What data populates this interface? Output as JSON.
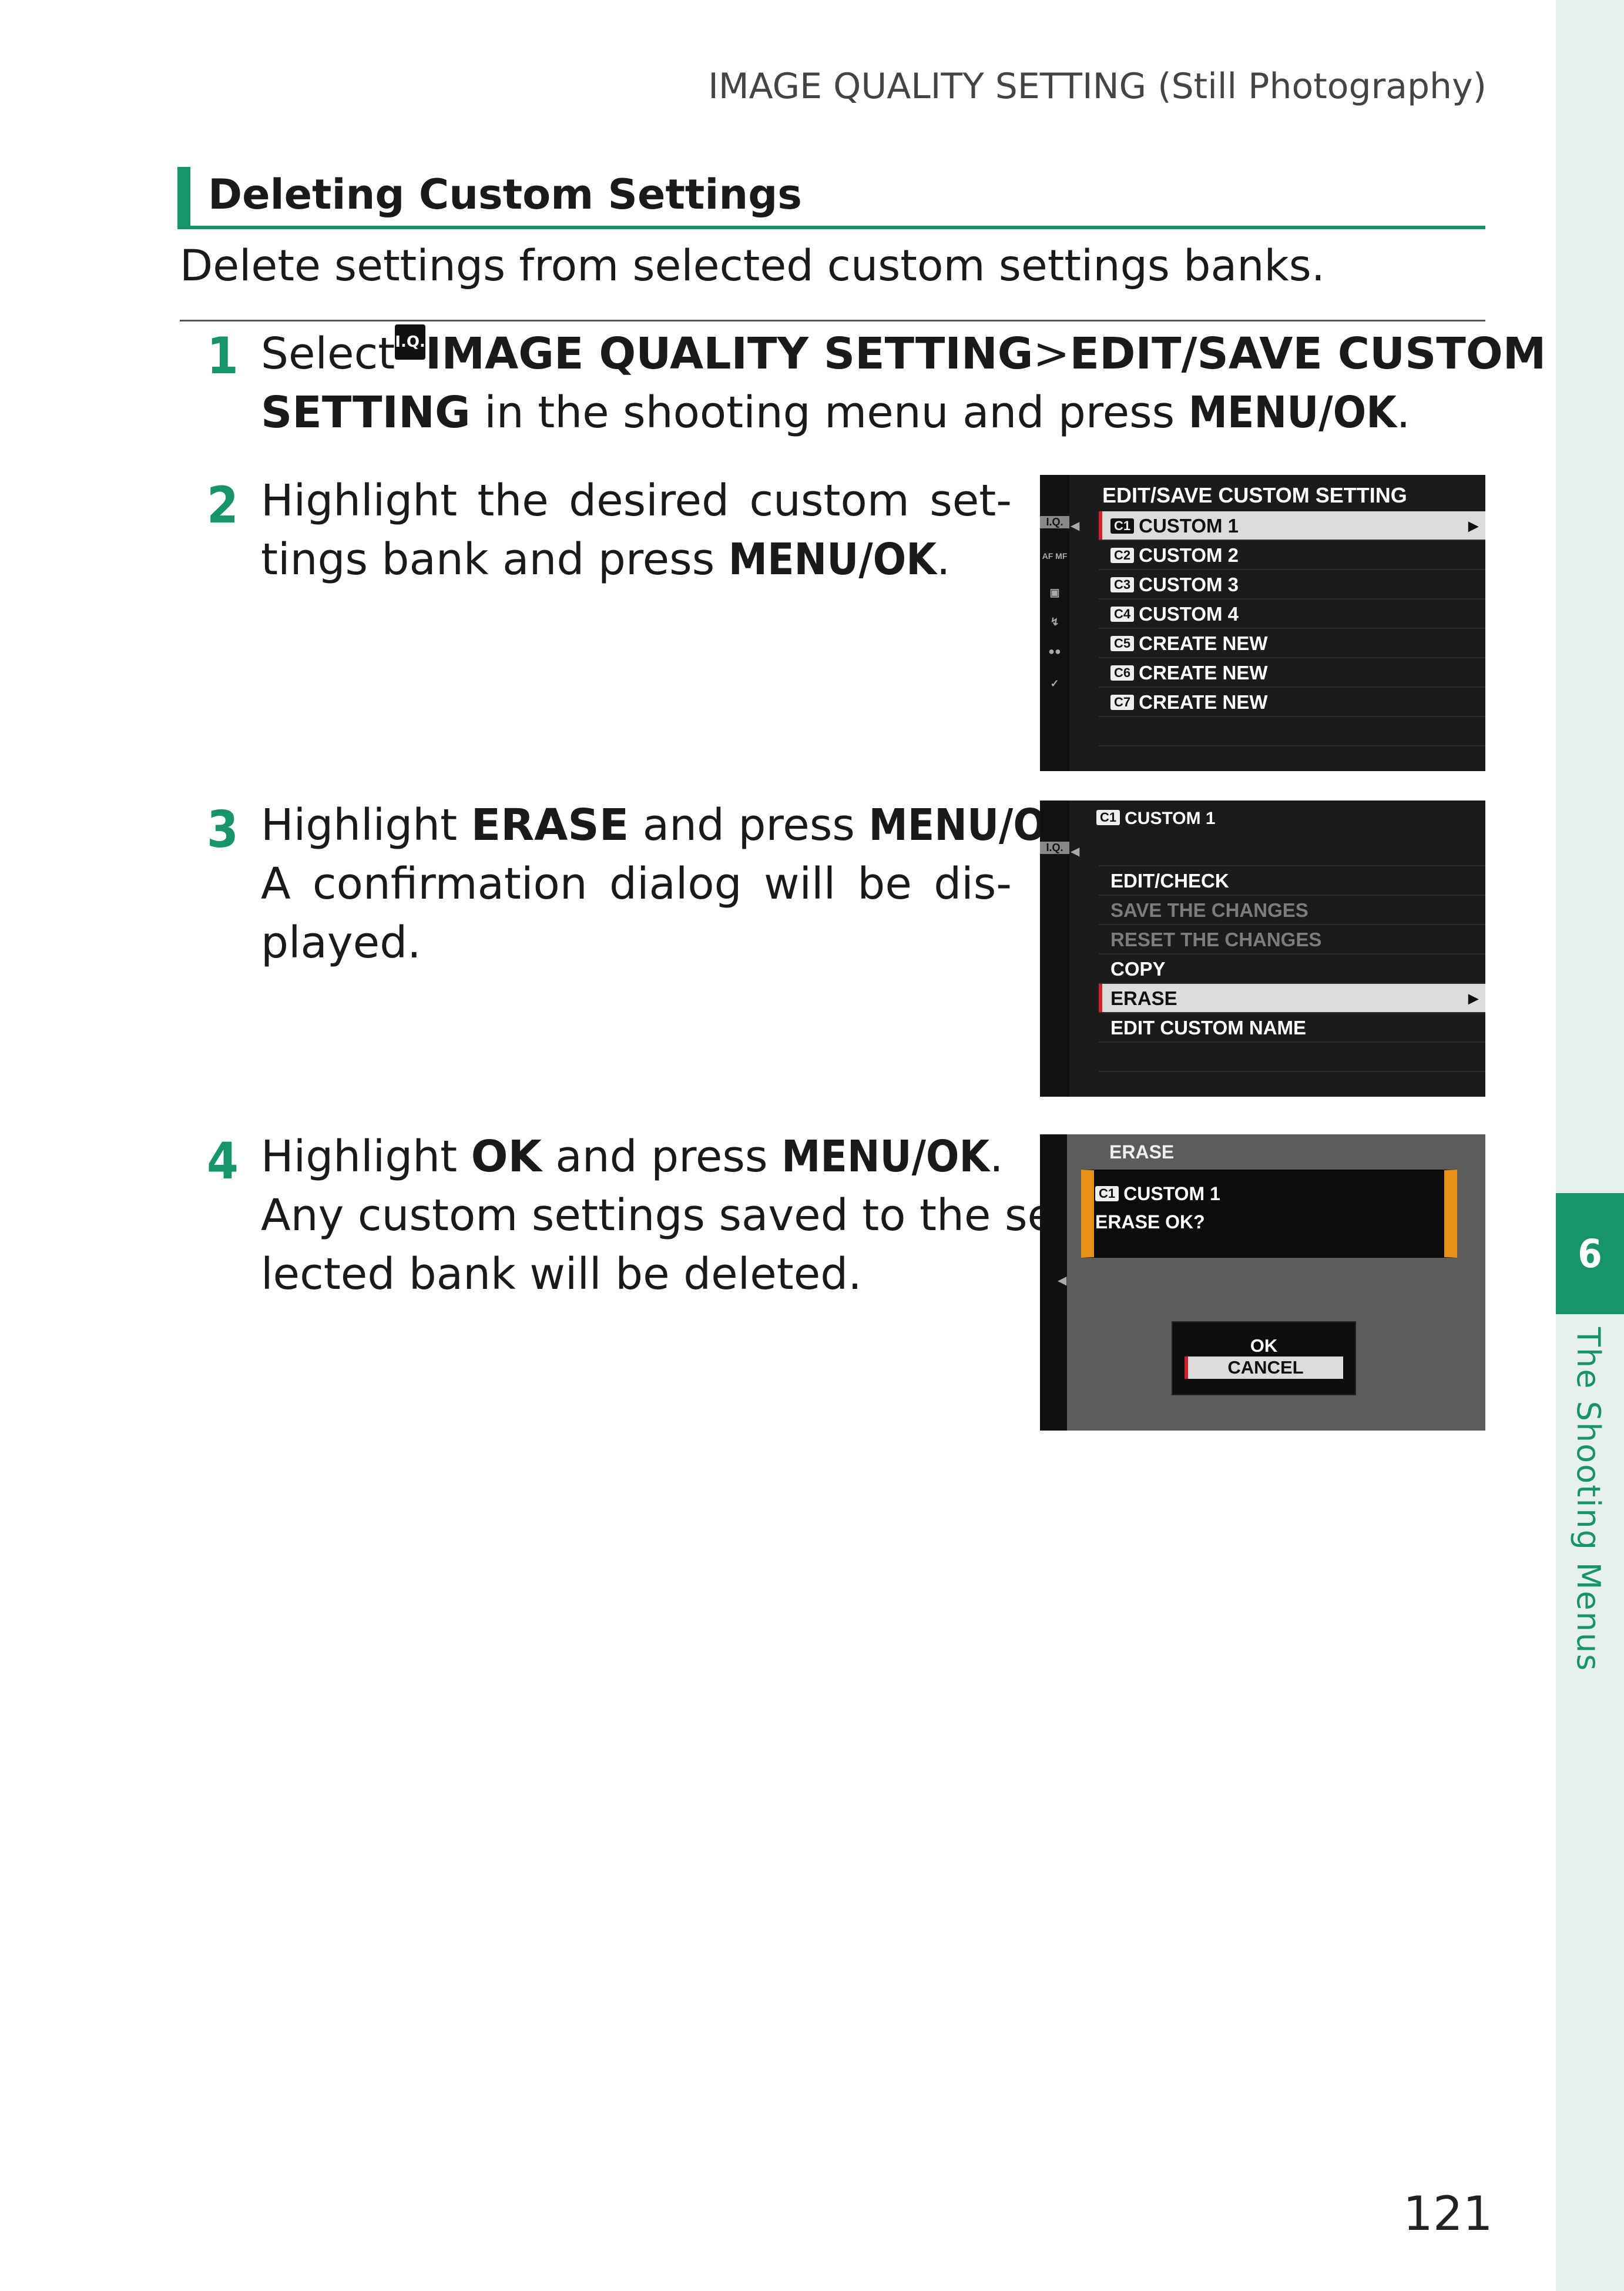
{
  "running_head": "IMAGE QUALITY SETTING (Still Photography)",
  "section": {
    "title": "Deleting Custom Settings",
    "intro": "Delete settings from selected custom settings banks."
  },
  "steps": [
    {
      "number": "1",
      "p1": "Select ",
      "icon_label": "I.Q.",
      "b1": "IMAGE QUALITY SETTING",
      "p2": " > ",
      "b2": "EDIT/SAVE CUSTOM",
      "b3": "SETTING",
      "p3": " in the shooting menu and press ",
      "key": "MENU/OK",
      "p4": "."
    },
    {
      "number": "2",
      "line1": "Highlight the desired custom set-",
      "line2_pre": "tings bank and press ",
      "key": "MENU/OK",
      "line2_post": "."
    },
    {
      "number": "3",
      "p1": "Highlight ",
      "b1": "ERASE",
      "p2": " and press ",
      "key": "MENU/OK",
      "p3": ".",
      "line2": "A confirmation dialog will be dis-",
      "line3": "played."
    },
    {
      "number": "4",
      "p1": "Highlight ",
      "b1": "OK",
      "p2": " and press ",
      "key": "MENU/OK",
      "p3": ".",
      "line2": "Any custom settings saved to the se-",
      "line3": "lected bank will be deleted."
    }
  ],
  "screen1": {
    "title": "EDIT/SAVE CUSTOM SETTING",
    "side_icons": [
      "I.Q.",
      "AF MF",
      "camera-icon",
      "flash-icon",
      "movie-icon",
      "wrench-icon"
    ],
    "rows": [
      {
        "badge": "C1",
        "label": "CUSTOM 1",
        "selected": true
      },
      {
        "badge": "C2",
        "label": "CUSTOM 2"
      },
      {
        "badge": "C3",
        "label": "CUSTOM 3"
      },
      {
        "badge": "C4",
        "label": "CUSTOM 4"
      },
      {
        "badge": "C5",
        "label": "CREATE NEW"
      },
      {
        "badge": "C6",
        "label": "CREATE NEW"
      },
      {
        "badge": "C7",
        "label": "CREATE NEW"
      }
    ]
  },
  "screen2": {
    "badge": "C1",
    "title": "CUSTOM 1",
    "side_icon": "I.Q.",
    "rows": [
      {
        "label": "EDIT/CHECK"
      },
      {
        "label": "SAVE THE CHANGES",
        "dim": true
      },
      {
        "label": "RESET THE CHANGES",
        "dim": true
      },
      {
        "label": "COPY"
      },
      {
        "label": "ERASE",
        "selected": true
      },
      {
        "label": "EDIT CUSTOM NAME"
      }
    ]
  },
  "screen3": {
    "title": "ERASE",
    "badge": "C1",
    "line1": "CUSTOM 1",
    "line2": "ERASE OK?",
    "ok": "OK",
    "cancel": "CANCEL"
  },
  "side_tab": {
    "chapter_number": "6",
    "chapter_title": "The Shooting Menus"
  },
  "page_number": "121"
}
